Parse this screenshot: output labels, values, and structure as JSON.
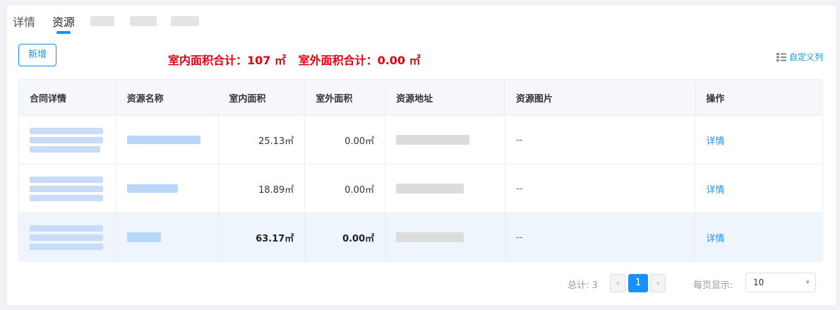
{
  "tabs": [
    {
      "label": "详情",
      "active": false
    },
    {
      "label": "资源",
      "active": true
    }
  ],
  "toolbar": {
    "add_label": "新增",
    "indoor_total": "室内面积合计：107 ㎡",
    "outdoor_total": "室外面积合计：0.00 ㎡",
    "custom_columns_label": "自定义列",
    "custom_columns_icon": "list-settings-icon"
  },
  "table": {
    "columns": [
      "合同详情",
      "资源名称",
      "室内面积",
      "室外面积",
      "资源地址",
      "资源图片",
      "操作"
    ],
    "rows": [
      {
        "indoor": "25.13㎡",
        "outdoor": "0.00㎡",
        "image": "--",
        "action": "详情"
      },
      {
        "indoor": "18.89㎡",
        "outdoor": "0.00㎡",
        "image": "--",
        "action": "详情"
      },
      {
        "indoor": "63.17㎡",
        "outdoor": "0.00㎡",
        "image": "--",
        "action": "详情"
      }
    ]
  },
  "pagination": {
    "total_label": "总计: 3",
    "prev": "‹",
    "next": "›",
    "current_page": "1",
    "page_size_label": "每页显示:",
    "page_size": "10"
  },
  "colors": {
    "accent": "#1890ff",
    "summary_red": "#e60012",
    "row_highlight": "#eef5fd"
  }
}
